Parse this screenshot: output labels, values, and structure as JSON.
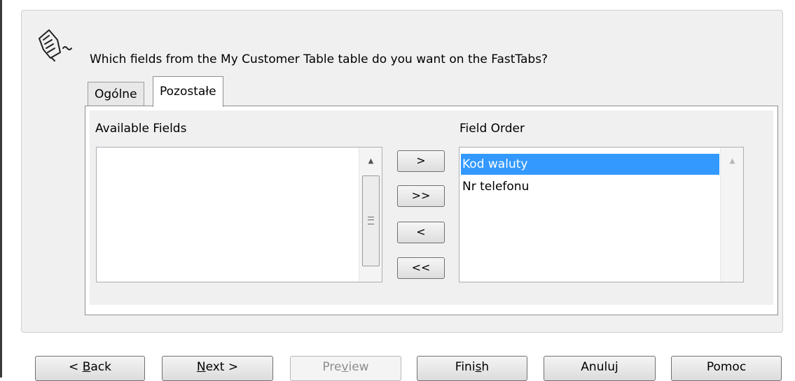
{
  "wizard": {
    "icon": "wizard-wand-icon",
    "question": "Which fields from the My Customer Table table do you want on the FastTabs?"
  },
  "tabs": [
    {
      "label": "Ogólne",
      "selected": false
    },
    {
      "label": "Pozostałe",
      "selected": true
    }
  ],
  "available_fields": {
    "label": "Available Fields",
    "items": []
  },
  "field_order": {
    "label": "Field Order",
    "items": [
      "Kod waluty",
      "Nr telefonu"
    ],
    "selected_index": 0
  },
  "move_buttons": {
    "add": ">",
    "add_all": ">>",
    "remove": "<",
    "remove_all": "<<"
  },
  "footer": {
    "back": {
      "pre": "< ",
      "key": "B",
      "post": "ack"
    },
    "next": {
      "pre": "",
      "key": "N",
      "post": "ext >"
    },
    "preview": {
      "pre": "Pre",
      "key": "v",
      "post": "iew",
      "disabled": true
    },
    "finish": {
      "pre": "Fini",
      "key": "s",
      "post": "h"
    },
    "cancel": "Anuluj",
    "help": "Pomoc"
  },
  "colors": {
    "selection": "#3399ff",
    "panel_bg": "#f0f0f0"
  }
}
